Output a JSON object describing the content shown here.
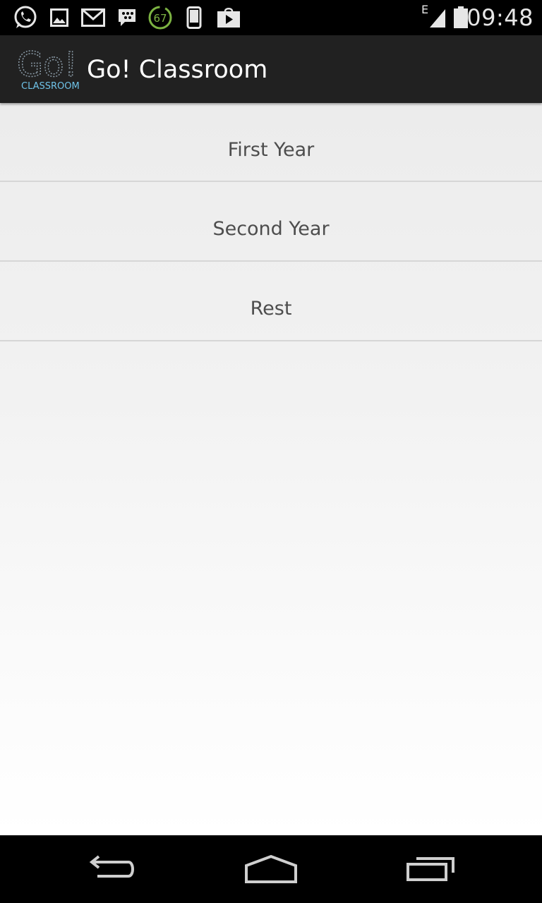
{
  "status_bar": {
    "time": "09:48",
    "network_type": "E",
    "notification_badge": "67",
    "icons": [
      "whatsapp-icon",
      "image-icon",
      "gmail-icon",
      "bbm-icon",
      "battery-saver-icon",
      "phone-icon",
      "play-store-icon",
      "signal-icon",
      "battery-icon"
    ]
  },
  "action_bar": {
    "logo_text": "Go!",
    "logo_subtext": "CLASSROOM",
    "title": "Go! Classroom"
  },
  "list": {
    "items": [
      {
        "label": "First Year"
      },
      {
        "label": "Second Year"
      },
      {
        "label": "Rest"
      }
    ]
  },
  "nav_bar": {
    "buttons": [
      "back-icon",
      "home-icon",
      "recents-icon"
    ]
  },
  "colors": {
    "status_bar_bg": "#000000",
    "action_bar_bg": "#212121",
    "list_text": "#4d4d4d",
    "divider": "#d6d6d6",
    "accent_green": "#7cb342"
  }
}
